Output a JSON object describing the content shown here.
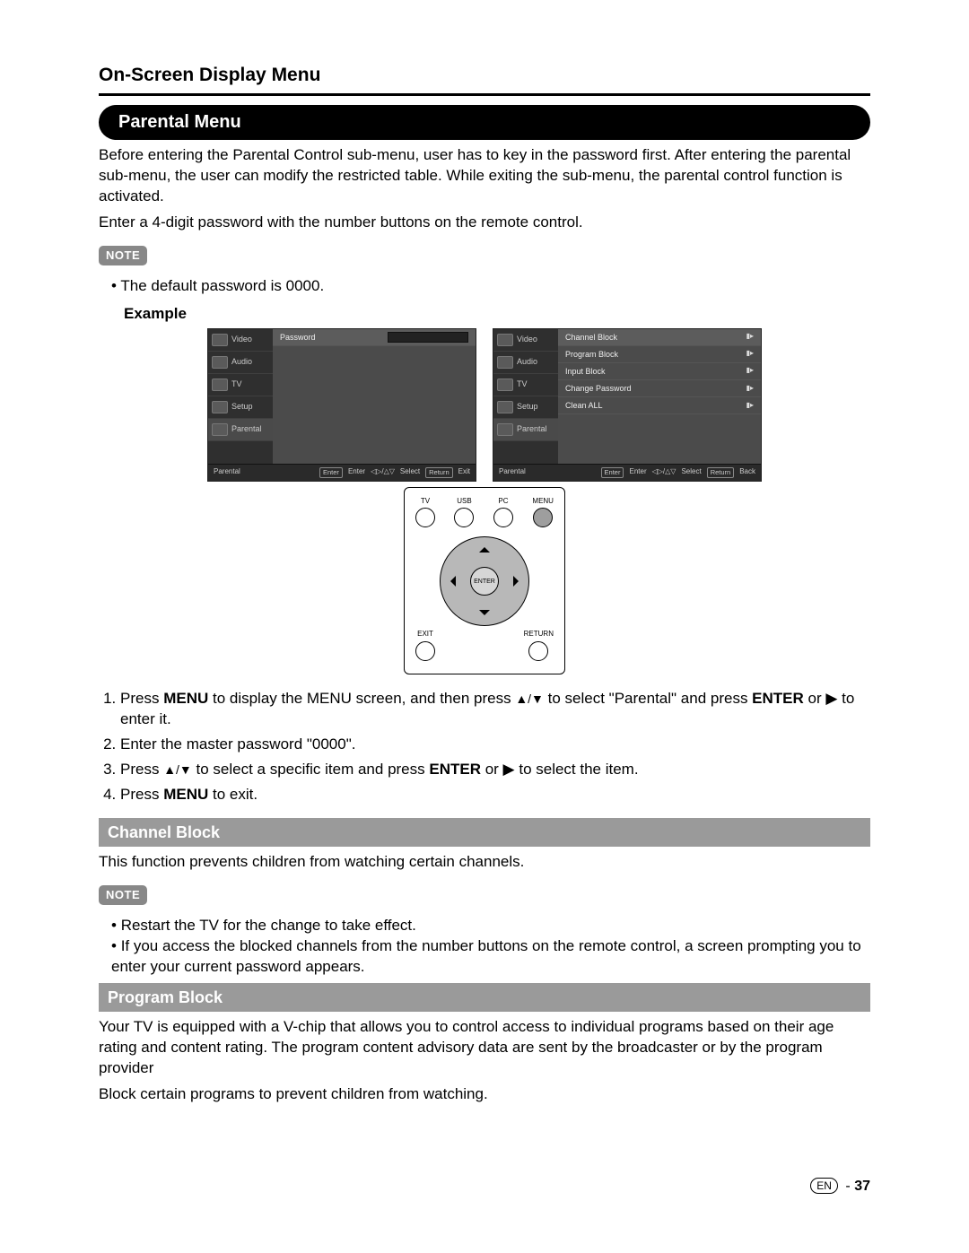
{
  "page_title": "On-Screen Display Menu",
  "section_title": "Parental Menu",
  "intro_paras": [
    "Before entering the Parental Control sub-menu, user has to key in the password first. After entering the parental sub-menu, the user can modify the restricted table. While exiting the sub-menu, the parental control function is activated.",
    "Enter a 4-digit password with the number buttons on the remote control."
  ],
  "note_label": "NOTE",
  "note1_bullets": [
    "The default password is 0000."
  ],
  "example_label": "Example",
  "osd": {
    "sidebar": [
      {
        "label": "Video"
      },
      {
        "label": "Audio"
      },
      {
        "label": "TV"
      },
      {
        "label": "Setup"
      },
      {
        "label": "Parental"
      }
    ],
    "left_main_rows": [
      {
        "label": "Password",
        "has_box": true
      }
    ],
    "right_main_rows": [
      {
        "label": "Channel Block"
      },
      {
        "label": "Program Block"
      },
      {
        "label": "Input Block"
      },
      {
        "label": "Change Password"
      },
      {
        "label": "Clean ALL"
      }
    ],
    "footer_left_title": "Parental",
    "footer_keys_left": [
      "Enter",
      "Enter",
      "◁▷/△▽",
      "Select",
      "Return",
      "Exit"
    ],
    "footer_keys_right": [
      "Enter",
      "Enter",
      "◁▷/△▽",
      "Select",
      "Return",
      "Back"
    ]
  },
  "remote": {
    "top": [
      "TV",
      "USB",
      "PC",
      "MENU"
    ],
    "center": "ENTER",
    "bottom_left": "EXIT",
    "bottom_right": "RETURN"
  },
  "steps": [
    {
      "n": "1.",
      "pre": "Press ",
      "bold1": "MENU",
      "mid": " to display the MENU screen, and then press ",
      "arrows": "▲/▼",
      "post": " to select \"Parental\" and press ",
      "bold2": "ENTER",
      "tail": "  or  ▶ to enter it."
    },
    {
      "n": "2.",
      "text": "Enter the master password \"0000\"."
    },
    {
      "n": "3.",
      "pre": "Press ",
      "arrows": "▲/▼",
      "mid": " to select a specific item and press ",
      "bold1": "ENTER",
      "post": " or  ▶  to select the item."
    },
    {
      "n": "4.",
      "pre": "Press ",
      "bold1": "MENU",
      "post": " to exit."
    }
  ],
  "channel_block": {
    "title": "Channel Block",
    "para": "This function prevents children from watching certain channels.",
    "bullets": [
      "Restart the TV for the change to take effect.",
      "If you access the blocked channels from the number buttons on the remote control, a screen prompting you to enter your current password appears."
    ]
  },
  "program_block": {
    "title": "Program Block",
    "paras": [
      "Your TV is equipped with a V-chip that allows you to control access to individual programs based on their age rating and content rating. The program content advisory data are sent by the broadcaster or by the program provider",
      "Block certain programs to prevent children from watching."
    ]
  },
  "footer": {
    "lang": "EN",
    "sep": "-",
    "page": "37"
  }
}
